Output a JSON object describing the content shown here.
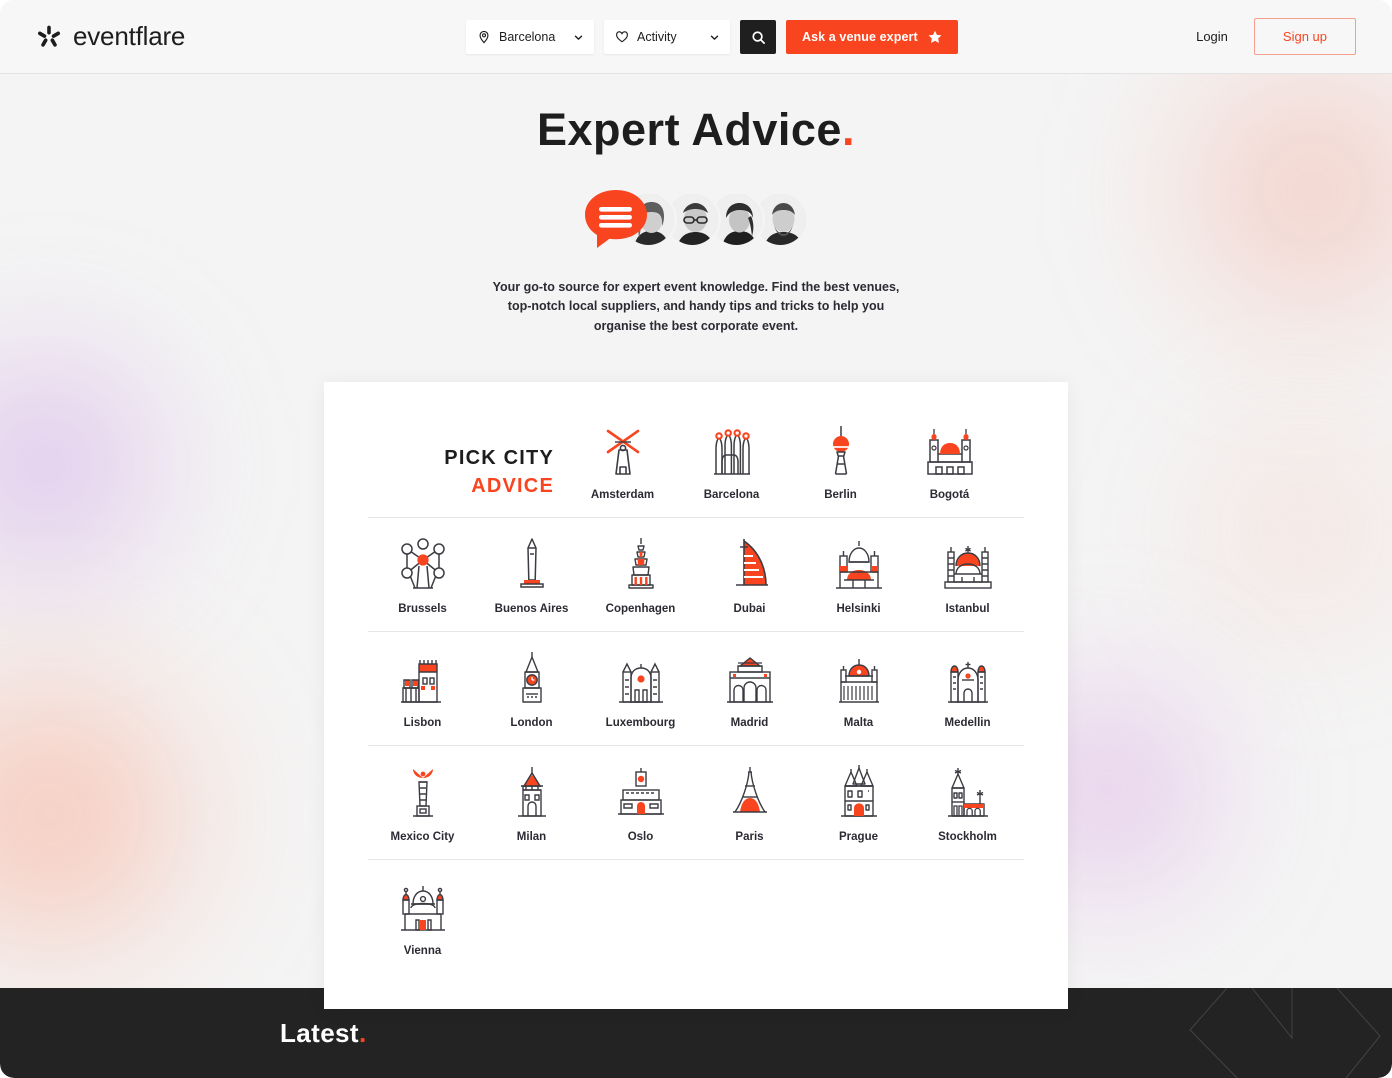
{
  "brand": {
    "name": "eventflare",
    "logo_icon": "eventflare-asterisk-icon"
  },
  "header": {
    "city_select": {
      "value": "Barcelona",
      "icon": "map-pin-icon",
      "chevron": "chevron-down-icon"
    },
    "activity_select": {
      "value": "Activity",
      "icon": "heart-icon",
      "chevron": "chevron-down-icon"
    },
    "search_button": {
      "icon": "search-icon"
    },
    "cta": {
      "label": "Ask a venue expert",
      "icon": "star-icon"
    },
    "login": "Login",
    "signup": "Sign up"
  },
  "hero": {
    "title": "Expert Advice",
    "title_dot": ".",
    "bubble_icon": "chat-bubble-icon",
    "subtitle": "Your go-to source for expert event knowledge. Find the best venues, top-notch local suppliers, and handy tips and tricks to help you organise the best corporate event."
  },
  "pick_city": {
    "line1": "PICK CITY",
    "line2": "ADVICE"
  },
  "cities": [
    {
      "name": "Amsterdam",
      "icon": "windmill-icon"
    },
    {
      "name": "Barcelona",
      "icon": "sagrada-familia-icon"
    },
    {
      "name": "Berlin",
      "icon": "tv-tower-icon"
    },
    {
      "name": "Bogotá",
      "icon": "cathedral-icon"
    },
    {
      "name": "Brussels",
      "icon": "atomium-icon"
    },
    {
      "name": "Buenos Aires",
      "icon": "obelisk-icon"
    },
    {
      "name": "Copenhagen",
      "icon": "spire-tower-icon"
    },
    {
      "name": "Dubai",
      "icon": "burj-al-arab-icon"
    },
    {
      "name": "Helsinki",
      "icon": "helsinki-cathedral-icon"
    },
    {
      "name": "Istanbul",
      "icon": "blue-mosque-icon"
    },
    {
      "name": "Lisbon",
      "icon": "belem-tower-icon"
    },
    {
      "name": "London",
      "icon": "big-ben-icon"
    },
    {
      "name": "Luxembourg",
      "icon": "palace-icon"
    },
    {
      "name": "Madrid",
      "icon": "puerta-alcala-icon"
    },
    {
      "name": "Malta",
      "icon": "domed-basilica-icon"
    },
    {
      "name": "Medellin",
      "icon": "medellin-cathedral-icon"
    },
    {
      "name": "Mexico City",
      "icon": "angel-monument-icon"
    },
    {
      "name": "Milan",
      "icon": "sforza-castle-icon"
    },
    {
      "name": "Oslo",
      "icon": "opera-house-icon"
    },
    {
      "name": "Paris",
      "icon": "eiffel-tower-icon"
    },
    {
      "name": "Prague",
      "icon": "powder-tower-icon"
    },
    {
      "name": "Stockholm",
      "icon": "city-hall-icon"
    },
    {
      "name": "Vienna",
      "icon": "karlskirche-icon"
    }
  ],
  "footer": {
    "title": "Latest",
    "title_dot": "."
  },
  "colors": {
    "accent": "#f9451f",
    "ink": "#1d1d1d",
    "page_bg": "#f4f4f4",
    "footer_bg": "#232323",
    "card_bg": "#ffffff"
  }
}
